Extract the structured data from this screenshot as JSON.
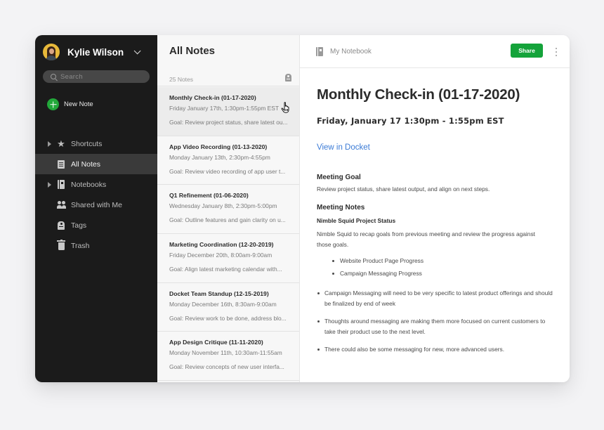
{
  "sidebar": {
    "user_name": "Kylie Wilson",
    "search_placeholder": "Search",
    "new_note_label": "New Note",
    "items": [
      {
        "label": "Shortcuts",
        "icon": "star-icon",
        "expandable": true,
        "active": false
      },
      {
        "label": "All Notes",
        "icon": "note-icon",
        "expandable": false,
        "active": true
      },
      {
        "label": "Notebooks",
        "icon": "notebook-icon",
        "expandable": true,
        "active": false
      },
      {
        "label": "Shared with Me",
        "icon": "people-icon",
        "expandable": false,
        "active": false
      },
      {
        "label": "Tags",
        "icon": "tag-icon",
        "expandable": false,
        "active": false
      },
      {
        "label": "Trash",
        "icon": "trash-icon",
        "expandable": false,
        "active": false
      }
    ]
  },
  "notes_list": {
    "title": "All Notes",
    "count": "25 Notes",
    "notes": [
      {
        "title": "Monthly Check-in (01-17-2020)",
        "date": "Friday January 17th, 1:30pm-1:55pm EST",
        "snippet": "Goal: Review project status, share latest ou...",
        "selected": true
      },
      {
        "title": "App Video Recording (01-13-2020)",
        "date": "Monday January 13th, 2:30pm-4:55pm",
        "snippet": "Goal: Review video recording of app user t...",
        "selected": false
      },
      {
        "title": "Q1 Refinement (01-06-2020)",
        "date": "Wednesday January 8th, 2:30pm-5:00pm",
        "snippet": "Goal: Outline features and gain clarity on u...",
        "selected": false
      },
      {
        "title": "Marketing Coordination (12-20-2019)",
        "date": "Friday December 20th, 8:00am-9:00am",
        "snippet": "Goal: Align latest marketing calendar with...",
        "selected": false
      },
      {
        "title": "Docket Team Standup (12-15-2019)",
        "date": "Monday December 16th, 8:30am-9:00am",
        "snippet": "Goal: Review work to be done, address blo...",
        "selected": false
      },
      {
        "title": "App Design Critique (11-11-2020)",
        "date": "Monday November 11th, 10:30am-11:55am",
        "snippet": "Goal: Review concepts of new user interfa...",
        "selected": false
      }
    ]
  },
  "editor": {
    "notebook_label": "My Notebook",
    "share_label": "Share",
    "title": "Monthly Check-in (01-17-2020)",
    "subtitle": "Friday, January 17 1:30pm - 1:55pm EST",
    "link_label": "View in Docket",
    "goal_heading": "Meeting Goal",
    "goal_text": "Review project status, share latest output, and align on next steps.",
    "notes_heading": "Meeting Notes",
    "notes_subheading": "Nimble Squid Project Status",
    "recap_text": "Nimble Squid to recap goals from previous meeting and review the progress against those goals.",
    "sub_bullets": [
      "Website Product Page Progress",
      "Campaign Messaging Progress"
    ],
    "bullets": [
      "Campaign Messaging will need to be very specific to latest product offerings and should be finalized by end of week",
      "Thoughts around messaging are making them more focused on current customers to take their product use to the next level.",
      "There could also be some messaging for new, more advanced users."
    ]
  },
  "colors": {
    "accent_green": "#14a33a",
    "link_blue": "#3b7bd6",
    "sidebar_bg": "#1b1b1b"
  }
}
